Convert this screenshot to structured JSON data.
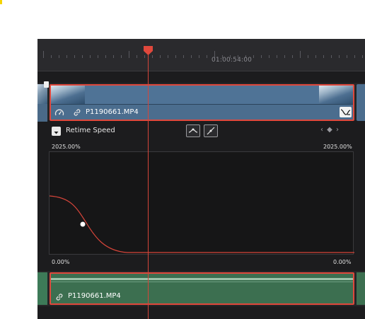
{
  "ruler": {
    "timecode": "01:00:54:00"
  },
  "video_track": {
    "clip": {
      "name": "P1190661.MP4",
      "speed_icon": "speedometer-icon",
      "link_icon": "link-icon",
      "curve_toggle_icon": "retime-curve-icon"
    }
  },
  "retime": {
    "dropdown_icon": "chevron-down-icon",
    "title": "Retime Speed",
    "ease_in_icon": "ease-in-out-icon",
    "linear_icon": "linear-curve-icon",
    "kf_nav": "‹ ◆ ›",
    "top_left_pct": "2025.00%",
    "top_right_pct": "2025.00%",
    "bottom_left_pct": "0.00%",
    "bottom_right_pct": "0.00%"
  },
  "audio_track": {
    "clip": {
      "name": "P1190661.MP4",
      "link_icon": "link-icon"
    }
  },
  "colors": {
    "selection_border": "#e0483c",
    "playhead": "#d6453a",
    "video_clip": "#4b6d8e",
    "audio_clip": "#3c6f50",
    "curve": "#d6453a"
  }
}
